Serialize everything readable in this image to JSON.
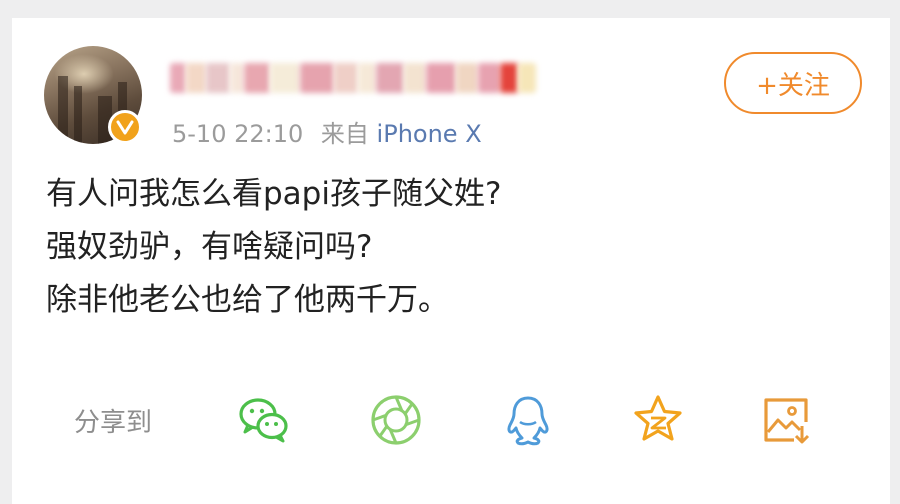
{
  "post": {
    "username_blurred": "",
    "meta": {
      "date": "5-10 22:10",
      "source_prefix": "来自",
      "source_device": "iPhone X"
    },
    "follow_label": "+关注",
    "lines": [
      "有人问我怎么看papi孩子随父姓?",
      "强奴劲驴，有啥疑问吗?",
      "除非他老公也给了他两千万。"
    ]
  },
  "share": {
    "label": "分享到",
    "targets": [
      {
        "icon": "wechat-icon"
      },
      {
        "icon": "wechat-moments-icon"
      },
      {
        "icon": "qq-icon"
      },
      {
        "icon": "qzone-star-icon"
      },
      {
        "icon": "save-image-icon"
      }
    ]
  },
  "colors": {
    "accent_orange": "#f08a2c",
    "wechat_green": "#4cbf4a",
    "qq_blue": "#4f9bd9",
    "star_orange": "#f2a31d",
    "meta_gray": "#9b9b9b",
    "text_dark": "#222222"
  }
}
